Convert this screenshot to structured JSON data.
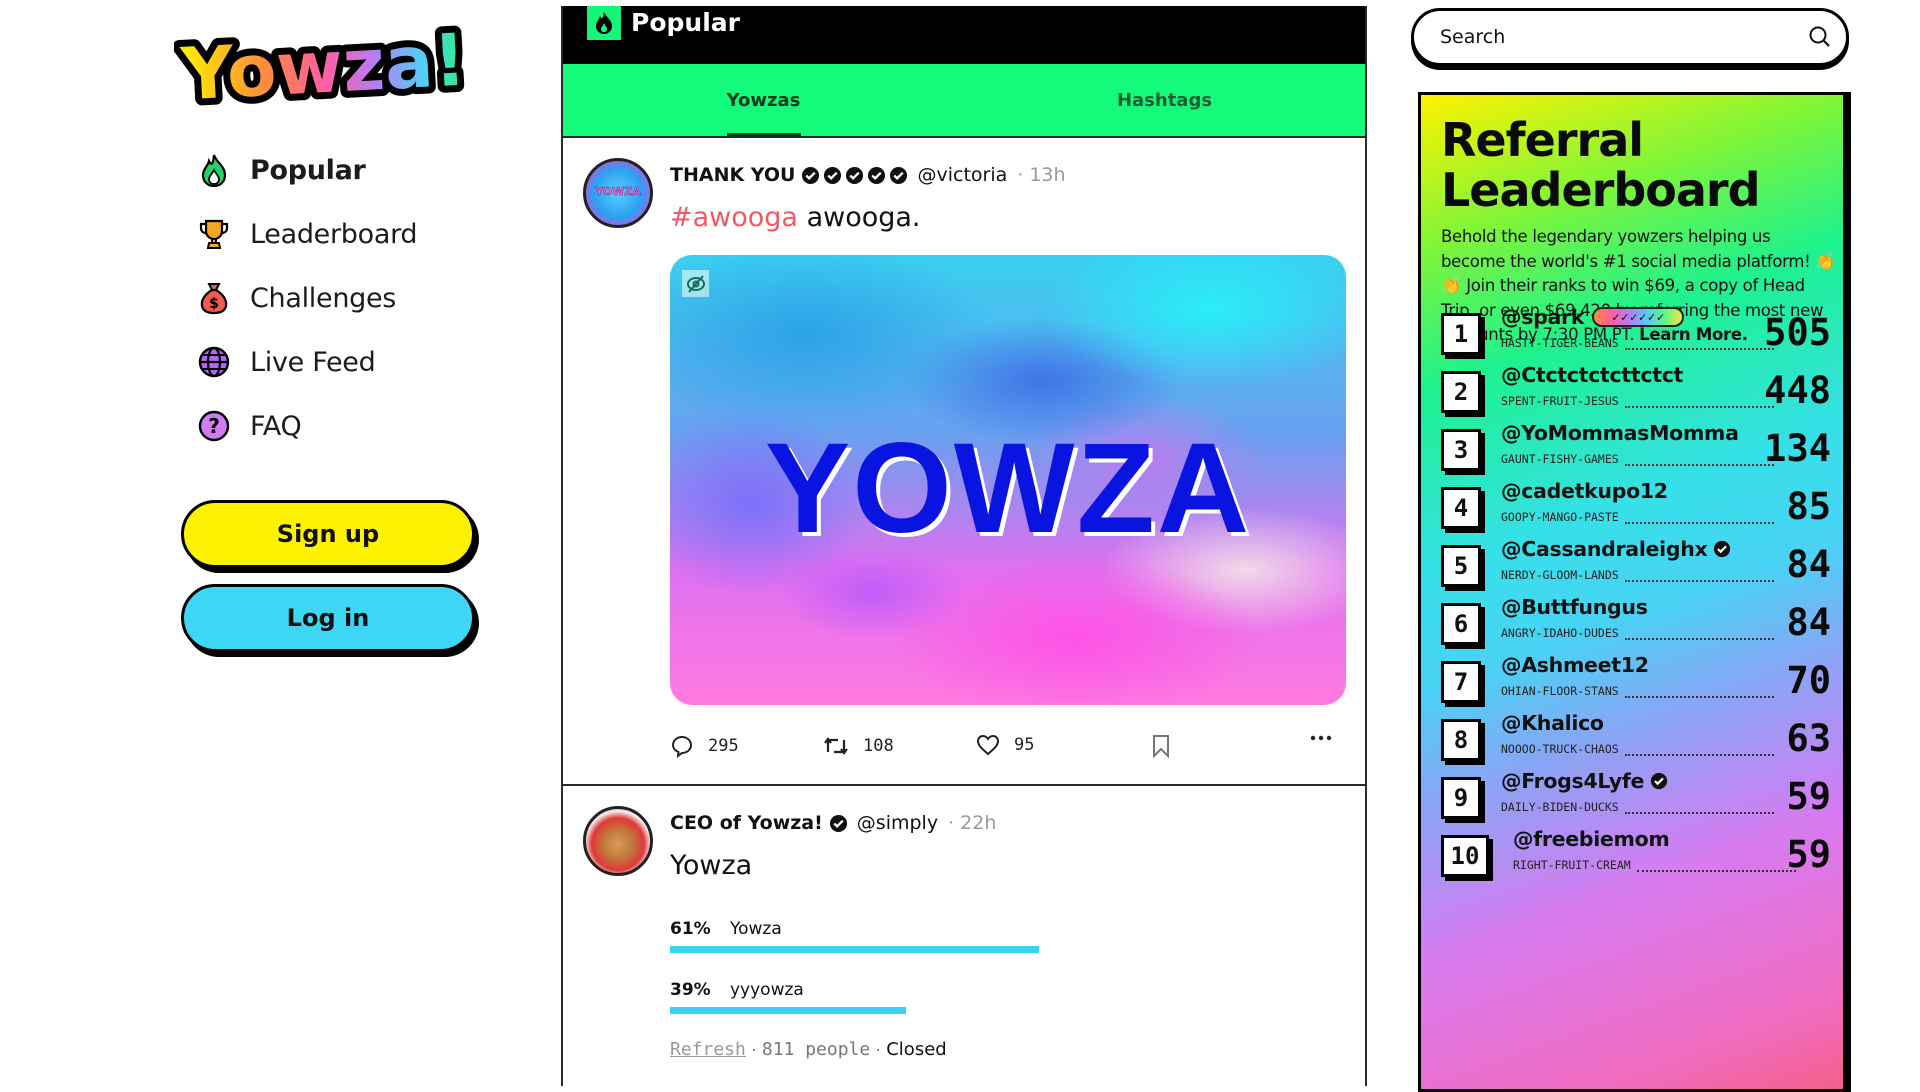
{
  "brand": {
    "logo_text": "Yowza!"
  },
  "sidebar": {
    "nav": [
      {
        "label": "Popular",
        "icon": "flame-icon",
        "color": "#22c55e",
        "active": true
      },
      {
        "label": "Leaderboard",
        "icon": "trophy-icon",
        "color": "#f5a623",
        "active": false
      },
      {
        "label": "Challenges",
        "icon": "money-bag-icon",
        "color": "#f05a4f",
        "active": false
      },
      {
        "label": "Live Feed",
        "icon": "globe-icon",
        "color": "#b565f5",
        "active": false
      },
      {
        "label": "FAQ",
        "icon": "question-icon",
        "color": "#d37bf5",
        "active": false
      }
    ],
    "signup_label": "Sign up",
    "login_label": "Log in",
    "signup_color": "#fff200",
    "login_color": "#3dd7f5"
  },
  "feed": {
    "header_title": "Popular",
    "tabs": [
      {
        "label": "Yowzas",
        "active": true
      },
      {
        "label": "Hashtags",
        "active": false
      }
    ],
    "posts": [
      {
        "display_name": "THANK YOU",
        "badge_count": 5,
        "handle": "@victoria",
        "time": "13h",
        "hashtag": "#awooga",
        "text": "awooga.",
        "avatar_text": "YOWZA",
        "image_text": "YOWZA",
        "stats": {
          "replies": "295",
          "reyowzas": "108",
          "likes": "95"
        }
      },
      {
        "display_name": "CEO of Yowza!",
        "handle": "@simply",
        "time": "22h",
        "text": "Yowza",
        "poll": {
          "options": [
            {
              "pct_label": "61%",
              "label": "Yowza",
              "value": 61
            },
            {
              "pct_label": "39%",
              "label": "yyyowza",
              "value": 39
            }
          ],
          "refresh_label": "Refresh",
          "people": "811 people",
          "status": "Closed"
        }
      }
    ]
  },
  "search": {
    "placeholder": "Search"
  },
  "leaderboard": {
    "title_line1": "Referral",
    "title_line2": "Leaderboard",
    "desc_text": "Behold the legendary yowzers helping us become the world's #1 social media platform! 👏👏 Join their ranks to win $69, a copy of Head Trip, or even $69,420 by referring the most new accounts by 7:30 PM PT.",
    "learn_more": "Learn More.",
    "rows": [
      {
        "rank": "1",
        "name": "@spark",
        "code": "HASTY-TIGER-BEANS",
        "score": "505",
        "badge": "rainbow"
      },
      {
        "rank": "2",
        "name": "@Ctctctctcttctct",
        "code": "SPENT-FRUIT-JESUS",
        "score": "448",
        "badge": ""
      },
      {
        "rank": "3",
        "name": "@YoMommasMomma",
        "code": "GAUNT-FISHY-GAMES",
        "score": "134",
        "badge": ""
      },
      {
        "rank": "4",
        "name": "@cadetkupo12",
        "code": "GOOPY-MANGO-PASTE",
        "score": "85",
        "badge": ""
      },
      {
        "rank": "5",
        "name": "@Cassandraleighx",
        "code": "NERDY-GLOOM-LANDS",
        "score": "84",
        "badge": "verified"
      },
      {
        "rank": "6",
        "name": "@Buttfungus",
        "code": "ANGRY-IDAHO-DUDES",
        "score": "84",
        "badge": ""
      },
      {
        "rank": "7",
        "name": "@Ashmeet12",
        "code": "OHIAN-FLOOR-STANS",
        "score": "70",
        "badge": ""
      },
      {
        "rank": "8",
        "name": "@Khalico",
        "code": "NOOOO-TRUCK-CHAOS",
        "score": "63",
        "badge": ""
      },
      {
        "rank": "9",
        "name": "@Frogs4Lyfe",
        "code": "DAILY-BIDEN-DUCKS",
        "score": "59",
        "badge": "verified"
      },
      {
        "rank": "10",
        "name": "@freebiemom",
        "code": "RIGHT-FRUIT-CREAM",
        "score": "59",
        "badge": ""
      }
    ]
  }
}
